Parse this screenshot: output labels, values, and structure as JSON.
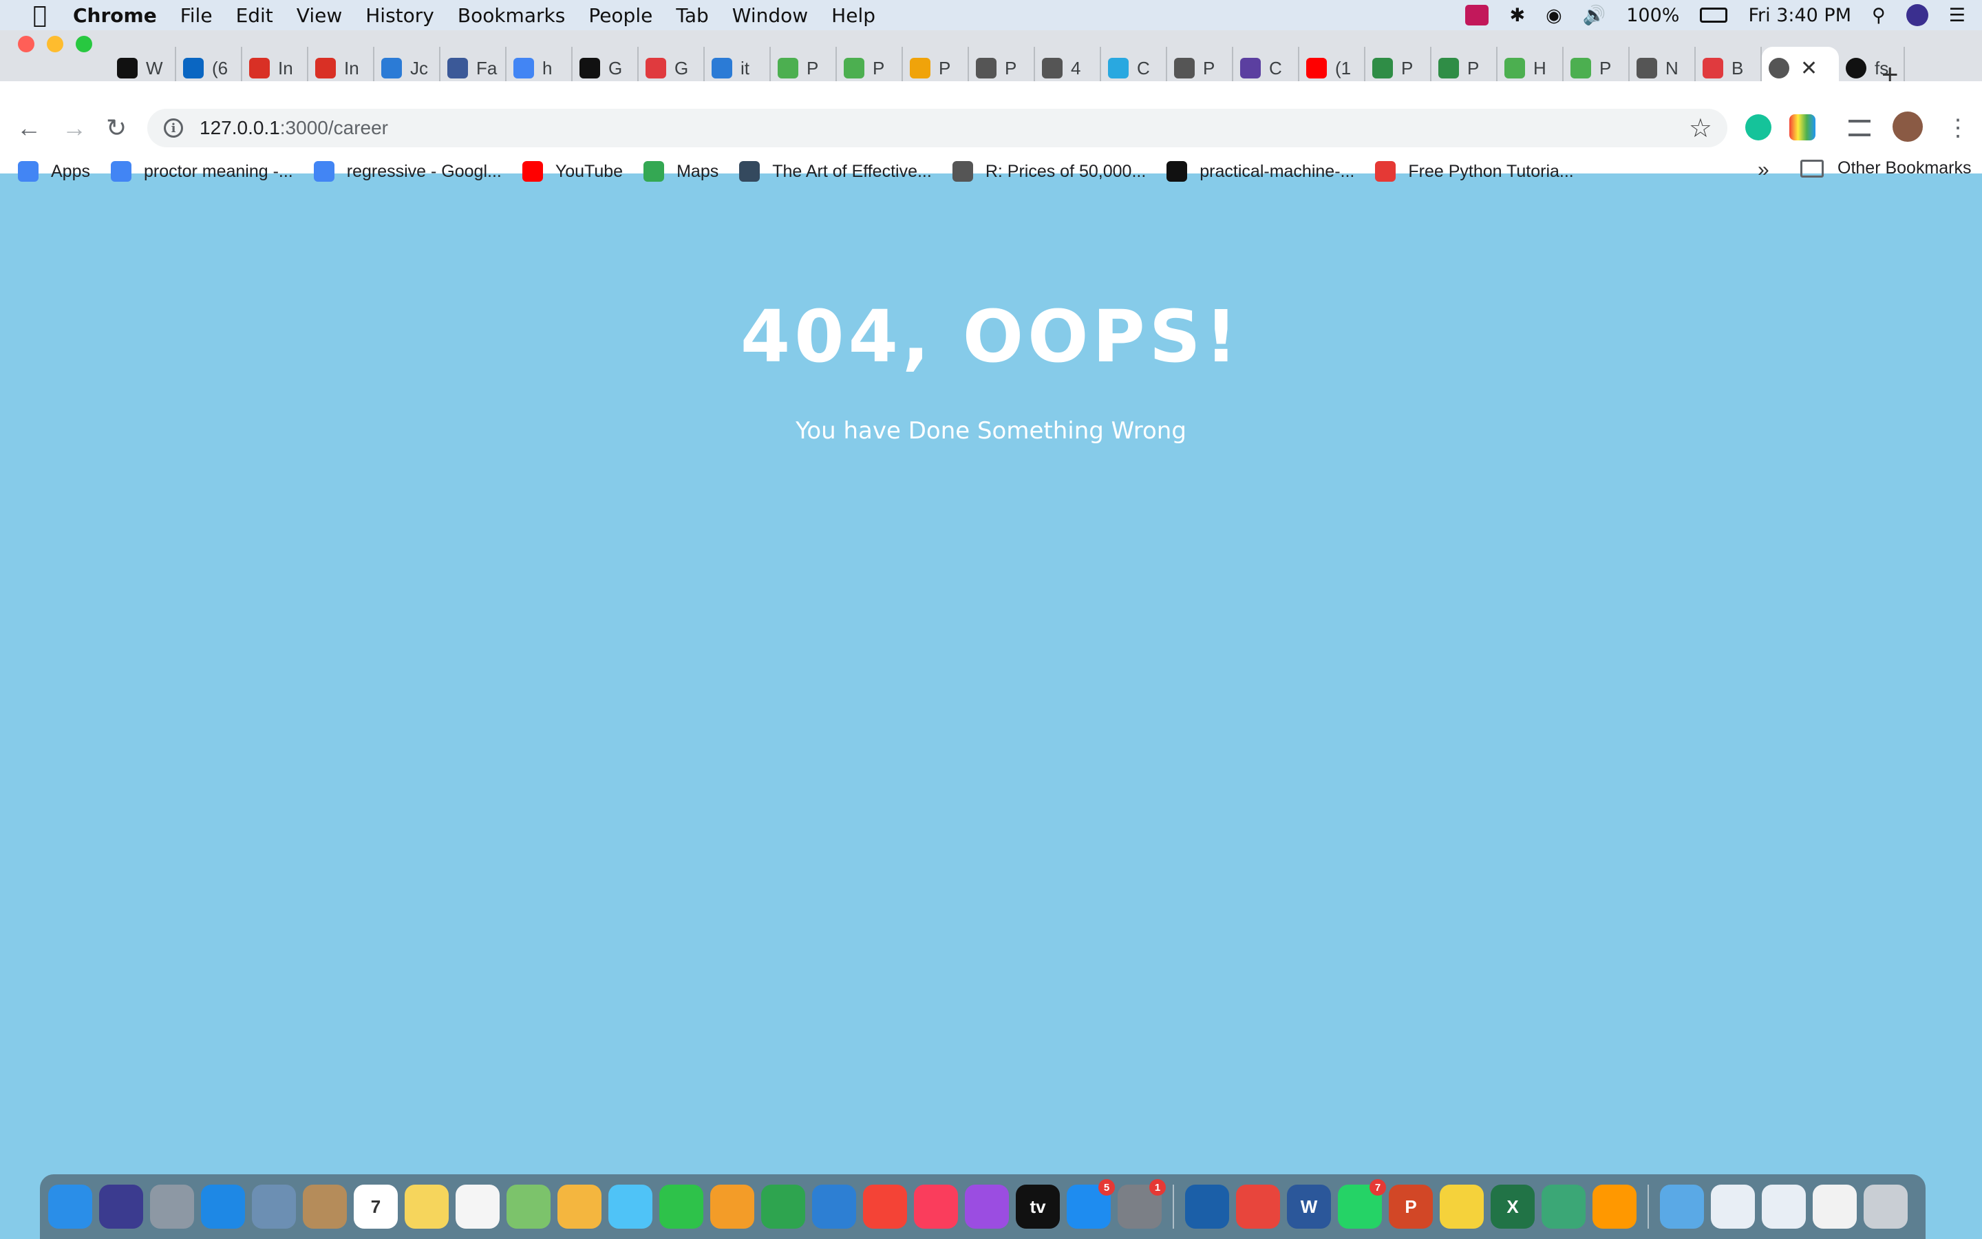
{
  "menubar": {
    "apple": "",
    "app": "Chrome",
    "items": [
      "File",
      "Edit",
      "View",
      "History",
      "Bookmarks",
      "People",
      "Tab",
      "Window",
      "Help"
    ],
    "battery": "100%",
    "clock": "Fri 3:40 PM"
  },
  "tabs": [
    {
      "icon": "amazon-icon",
      "label": "W",
      "color": "#111"
    },
    {
      "icon": "linkedin-icon",
      "label": "(6",
      "color": "#0a66c2"
    },
    {
      "icon": "gmail-icon",
      "label": "In",
      "color": "#d93025"
    },
    {
      "icon": "gmail-icon",
      "label": "In",
      "color": "#d93025"
    },
    {
      "icon": "w-icon",
      "label": "Jc",
      "color": "#2b7bd6"
    },
    {
      "icon": "facebook-icon",
      "label": "Fa",
      "color": "#3b5998"
    },
    {
      "icon": "google-icon",
      "label": "h",
      "color": "#4285f4"
    },
    {
      "icon": "github-icon",
      "label": "G",
      "color": "#111"
    },
    {
      "icon": "redhat-icon",
      "label": "G",
      "color": "#e03a3e"
    },
    {
      "icon": "chart-icon",
      "label": "it",
      "color": "#2b7bd6"
    },
    {
      "icon": "w3-icon",
      "label": "P",
      "color": "#4caf50"
    },
    {
      "icon": "w3-icon",
      "label": "P",
      "color": "#4caf50"
    },
    {
      "icon": "pen-icon",
      "label": "P",
      "color": "#f0a30a"
    },
    {
      "icon": "globe-icon",
      "label": "P",
      "color": "#555"
    },
    {
      "icon": "doc-icon",
      "label": "4",
      "color": "#555"
    },
    {
      "icon": "spinner-icon",
      "label": "C",
      "color": "#29a8e0"
    },
    {
      "icon": "terminal-icon",
      "label": "P",
      "color": "#555"
    },
    {
      "icon": "bolt-icon",
      "label": "C",
      "color": "#5b3fa0"
    },
    {
      "icon": "youtube-icon",
      "label": "(1",
      "color": "#ff0000"
    },
    {
      "icon": "geeks-icon",
      "label": "P",
      "color": "#2f8d46"
    },
    {
      "icon": "geeks-icon",
      "label": "P",
      "color": "#2f8d46"
    },
    {
      "icon": "w3-icon",
      "label": "H",
      "color": "#4caf50"
    },
    {
      "icon": "w3-icon",
      "label": "P",
      "color": "#4caf50"
    },
    {
      "icon": "diamond-icon",
      "label": "N",
      "color": "#555"
    },
    {
      "icon": "redhat-icon",
      "label": "B",
      "color": "#e03a3e"
    }
  ],
  "active_tab": {
    "icon": "globe-icon",
    "label": ""
  },
  "last_tab": {
    "icon": "github-icon",
    "label": "fs"
  },
  "address": {
    "host": "127.0.0.1",
    "path": ":3000/career"
  },
  "bookmarks": [
    {
      "icon": "apps-icon",
      "label": "Apps",
      "color": "#4285f4"
    },
    {
      "icon": "google-icon",
      "label": "proctor meaning -...",
      "color": "#4285f4"
    },
    {
      "icon": "google-icon",
      "label": "regressive - Googl...",
      "color": "#4285f4"
    },
    {
      "icon": "youtube-icon",
      "label": "YouTube",
      "color": "#ff0000"
    },
    {
      "icon": "maps-icon",
      "label": "Maps",
      "color": "#34a853"
    },
    {
      "icon": "book-icon",
      "label": "The Art of Effective...",
      "color": "#34495e"
    },
    {
      "icon": "globe-icon",
      "label": "R: Prices of 50,000...",
      "color": "#555"
    },
    {
      "icon": "github-icon",
      "label": "practical-machine-...",
      "color": "#111"
    },
    {
      "icon": "udemy-icon",
      "label": "Free Python Tutoria...",
      "color": "#e53935"
    }
  ],
  "bookmarks_more": "»",
  "other_bookmarks": "Other Bookmarks",
  "page": {
    "title": "404, OOPS!",
    "subtitle": "You have Done Something Wrong"
  },
  "dock": [
    {
      "name": "finder",
      "color": "#2a8ee8"
    },
    {
      "name": "siri",
      "color": "#3b3b8f"
    },
    {
      "name": "launchpad",
      "color": "#8d98a4"
    },
    {
      "name": "safari",
      "color": "#1e88e5"
    },
    {
      "name": "preview",
      "color": "#6c8fb3"
    },
    {
      "name": "contacts",
      "color": "#b58c5a"
    },
    {
      "name": "calendar",
      "color": "#ffffff",
      "text": "7"
    },
    {
      "name": "notes",
      "color": "#f6d55c"
    },
    {
      "name": "reminders",
      "color": "#f5f5f5"
    },
    {
      "name": "maps",
      "color": "#7cc36b"
    },
    {
      "name": "photos",
      "color": "#f4b63f"
    },
    {
      "name": "messages",
      "color": "#4fc3f7"
    },
    {
      "name": "facetime",
      "color": "#2ec24a"
    },
    {
      "name": "pages",
      "color": "#f39c28"
    },
    {
      "name": "numbers",
      "color": "#2ea44f"
    },
    {
      "name": "keynote",
      "color": "#2d7fd3"
    },
    {
      "name": "news",
      "color": "#f44336"
    },
    {
      "name": "music",
      "color": "#fa3d5c"
    },
    {
      "name": "podcasts",
      "color": "#9b4de1"
    },
    {
      "name": "apple-tv",
      "color": "#111111",
      "text": "tv"
    },
    {
      "name": "app-store",
      "color": "#1e8cf0",
      "badge": "5"
    },
    {
      "name": "system-preferences",
      "color": "#7b7f86",
      "badge": "1"
    },
    {
      "name": "virtualbox",
      "color": "#1b5fa8"
    },
    {
      "name": "chrome",
      "color": "#e8453c"
    },
    {
      "name": "word",
      "color": "#2b579a",
      "text": "W"
    },
    {
      "name": "whatsapp",
      "color": "#25d366",
      "badge": "7"
    },
    {
      "name": "powerpoint",
      "color": "#d24726",
      "text": "P"
    },
    {
      "name": "python",
      "color": "#f5d23b"
    },
    {
      "name": "excel",
      "color": "#217346",
      "text": "X"
    },
    {
      "name": "atom",
      "color": "#3ba776"
    },
    {
      "name": "sublime-text",
      "color": "#ff9800"
    },
    {
      "name": "downloads-folder",
      "color": "#5aa9e6"
    },
    {
      "name": "document",
      "color": "#e8eef5"
    },
    {
      "name": "document",
      "color": "#e8eef5"
    },
    {
      "name": "document",
      "color": "#f2f2f2"
    },
    {
      "name": "trash",
      "color": "#c9ced4"
    }
  ]
}
